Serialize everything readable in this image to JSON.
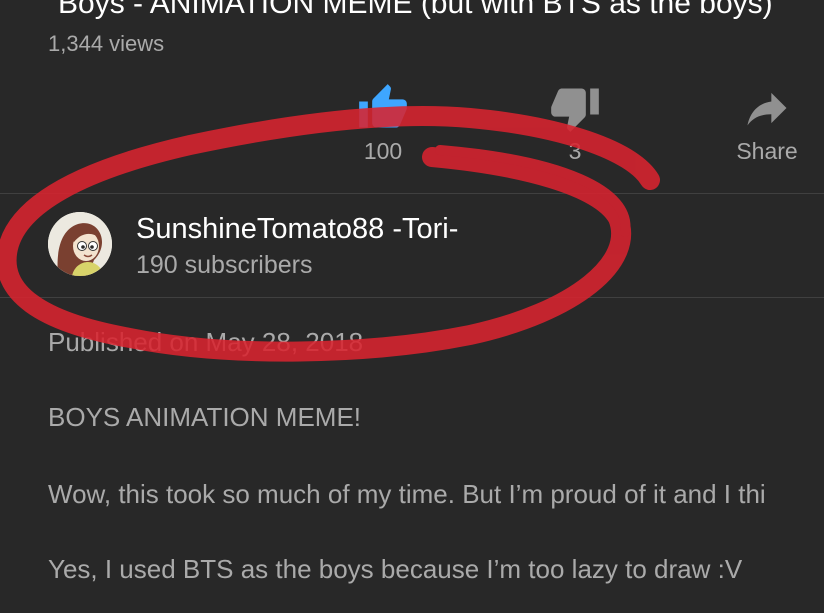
{
  "video": {
    "title": "Boys - ANIMATION MEME (but with BTS as the boys)",
    "views": "1,344 views"
  },
  "actions": {
    "like": {
      "count": "100",
      "icon": "thumbs-up-icon",
      "color": "#3ea6ff"
    },
    "dislike": {
      "count": "3",
      "icon": "thumbs-down-icon"
    },
    "share": {
      "label": "Share",
      "icon": "share-icon"
    }
  },
  "channel": {
    "name": "SunshineTomato88 -Tori-",
    "subscribers": "190 subscribers"
  },
  "description": {
    "published": "Published on May 28, 2018",
    "lines": [
      "BOYS ANIMATION MEME!",
      "Wow, this took so much of my time. But I’m proud of it and I thi",
      "Yes, I used BTS as the boys because I’m too lazy to draw :V"
    ]
  },
  "annotation_color": "#d8232f"
}
